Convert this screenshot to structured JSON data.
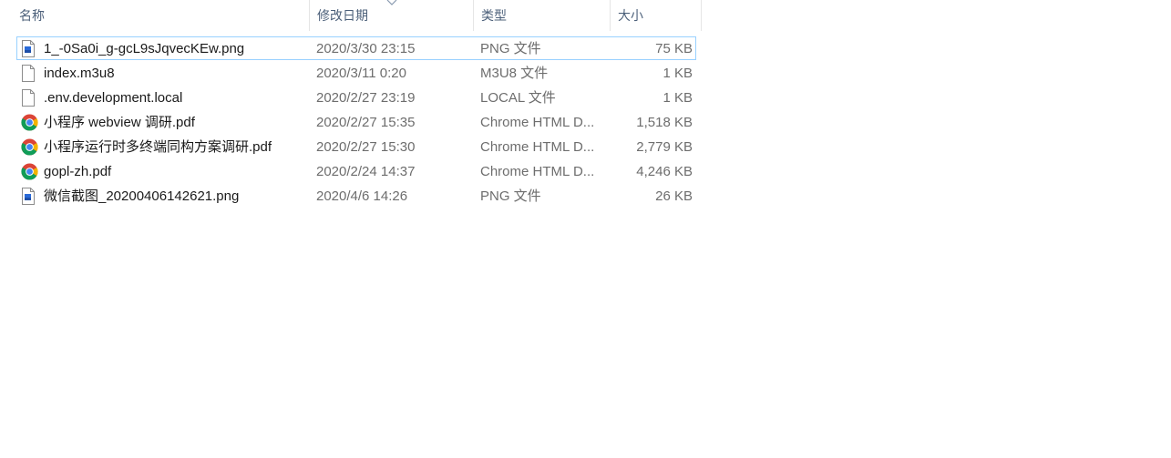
{
  "columns": {
    "name": "名称",
    "date": "修改日期",
    "type": "类型",
    "size": "大小"
  },
  "files": [
    {
      "name": "1_-0Sa0i_g-gcL9sJqvecKEw.png",
      "date": "2020/3/30 23:15",
      "type": "PNG 文件",
      "size": "75 KB",
      "icon": "image-file-icon"
    },
    {
      "name": "index.m3u8",
      "date": "2020/3/11 0:20",
      "type": "M3U8 文件",
      "size": "1 KB",
      "icon": "blank-file-icon"
    },
    {
      "name": ".env.development.local",
      "date": "2020/2/27 23:19",
      "type": "LOCAL 文件",
      "size": "1 KB",
      "icon": "blank-file-icon"
    },
    {
      "name": "小程序 webview 调研.pdf",
      "date": "2020/2/27 15:35",
      "type": "Chrome HTML D...",
      "size": "1,518 KB",
      "icon": "chrome-icon"
    },
    {
      "name": "小程序运行时多终端同构方案调研.pdf",
      "date": "2020/2/27 15:30",
      "type": "Chrome HTML D...",
      "size": "2,779 KB",
      "icon": "chrome-icon"
    },
    {
      "name": "gopl-zh.pdf",
      "date": "2020/2/24 14:37",
      "type": "Chrome HTML D...",
      "size": "4,246 KB",
      "icon": "chrome-icon"
    },
    {
      "name": "微信截图_20200406142621.png",
      "date": "2020/4/6 14:26",
      "type": "PNG 文件",
      "size": "26 KB",
      "icon": "image-file-icon"
    }
  ]
}
